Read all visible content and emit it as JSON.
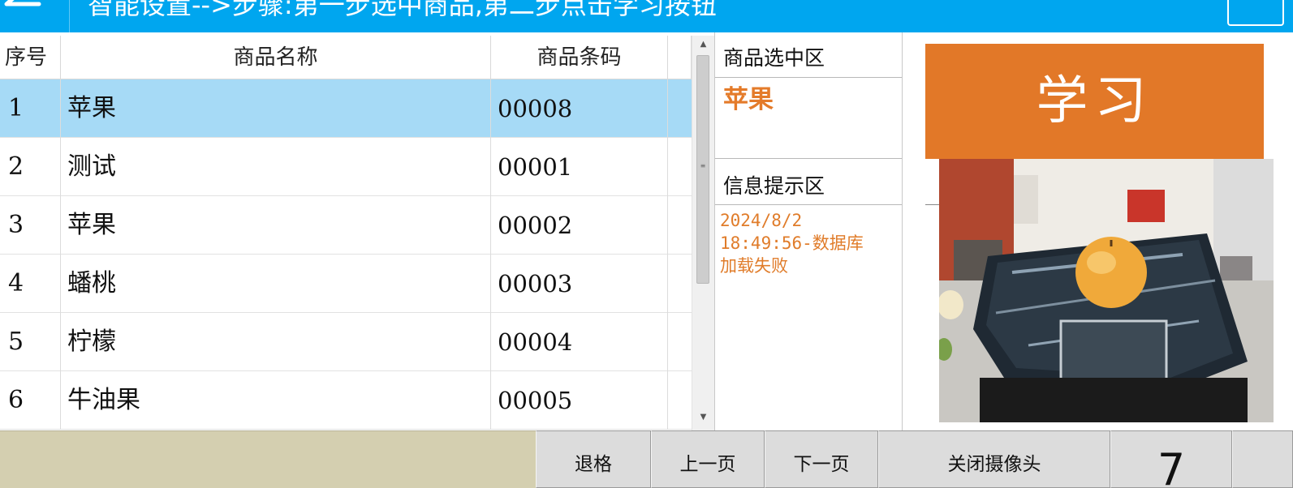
{
  "header": {
    "title": "智能设置-->步骤:第一步选中商品,第二步点击学习按钮",
    "bg_color": "#00a6ef",
    "back_icon": "arrow-left-icon"
  },
  "table": {
    "columns": [
      "序号",
      "商品名称",
      "商品条码"
    ],
    "rows": [
      {
        "idx": "1",
        "name": "苹果",
        "code": "00008"
      },
      {
        "idx": "2",
        "name": "测试",
        "code": "00001"
      },
      {
        "idx": "3",
        "name": "苹果",
        "code": "00002"
      },
      {
        "idx": "4",
        "name": "蟠桃",
        "code": "00003"
      },
      {
        "idx": "5",
        "name": "柠檬",
        "code": "00004"
      },
      {
        "idx": "6",
        "name": "牛油果",
        "code": "00005"
      }
    ],
    "selected_row": 0,
    "selected_color": "#a6daf6"
  },
  "panel": {
    "selected_label": "商品选中区",
    "selected_value": "苹果",
    "info_label": "信息提示区",
    "info_lines": [
      "2024/8/2",
      "18:49:56-数据库",
      "加载失败"
    ],
    "accent_color": "#e27828"
  },
  "learn_button": "学习",
  "bottom": {
    "backspace": "退格",
    "prev_page": "上一页",
    "next_page": "下一页",
    "close_camera": "关闭摄像头",
    "key_7": "7"
  }
}
